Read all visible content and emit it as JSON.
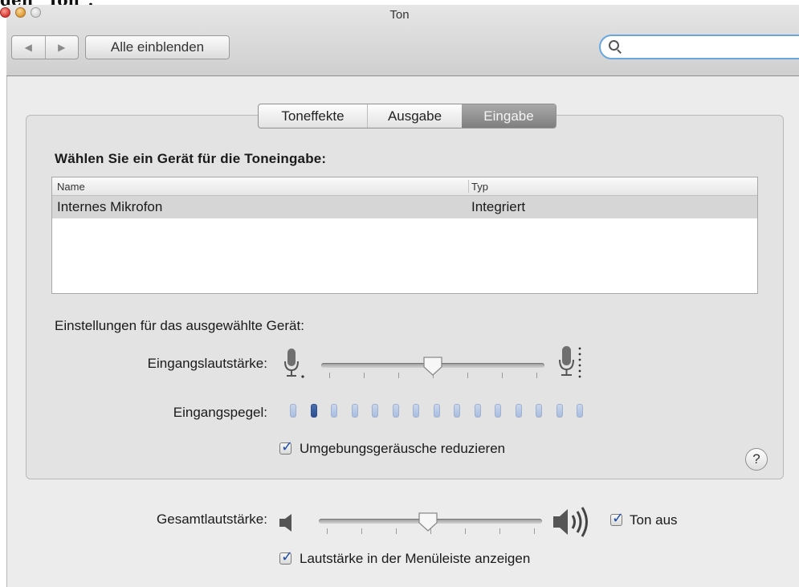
{
  "clipped_heading": "den \"Ton\".",
  "window": {
    "title": "Ton"
  },
  "toolbar": {
    "back_label": "◀",
    "forward_label": "▶",
    "show_all_label": "Alle einblenden",
    "search_placeholder": ""
  },
  "tabs": [
    {
      "label": "Toneffekte",
      "active": false
    },
    {
      "label": "Ausgabe",
      "active": false
    },
    {
      "label": "Eingabe",
      "active": true
    }
  ],
  "input_panel": {
    "heading": "Wählen Sie ein Gerät für die Toneingabe:",
    "table": {
      "columns": [
        "Name",
        "Typ"
      ],
      "rows": [
        {
          "name": "Internes Mikrofon",
          "type": "Integriert",
          "selected": true
        }
      ]
    },
    "settings_label": "Einstellungen für das ausgewählte Gerät:",
    "input_volume_label": "Eingangslautstärke:",
    "input_volume_value": 0.5,
    "input_level_label": "Eingangspegel:",
    "input_level_total_bars": 15,
    "input_level_active_bars": 1,
    "noise_reduction_label": "Umgebungsgeräusche reduzieren",
    "noise_reduction_checked": true,
    "help_label": "?"
  },
  "output": {
    "master_volume_label": "Gesamtlautstärke:",
    "master_volume_value": 0.49,
    "mute_label": "Ton aus",
    "mute_checked": true,
    "show_in_menubar_label": "Lautstärke in der Menüleiste anzeigen",
    "show_in_menubar_checked": true
  },
  "colors": {
    "accent_blue": "#6aa7df",
    "level_active": "#2d4f91",
    "level_inactive": "#b7c6e3",
    "close": "#e0443e",
    "minimize": "#e6a13a"
  }
}
